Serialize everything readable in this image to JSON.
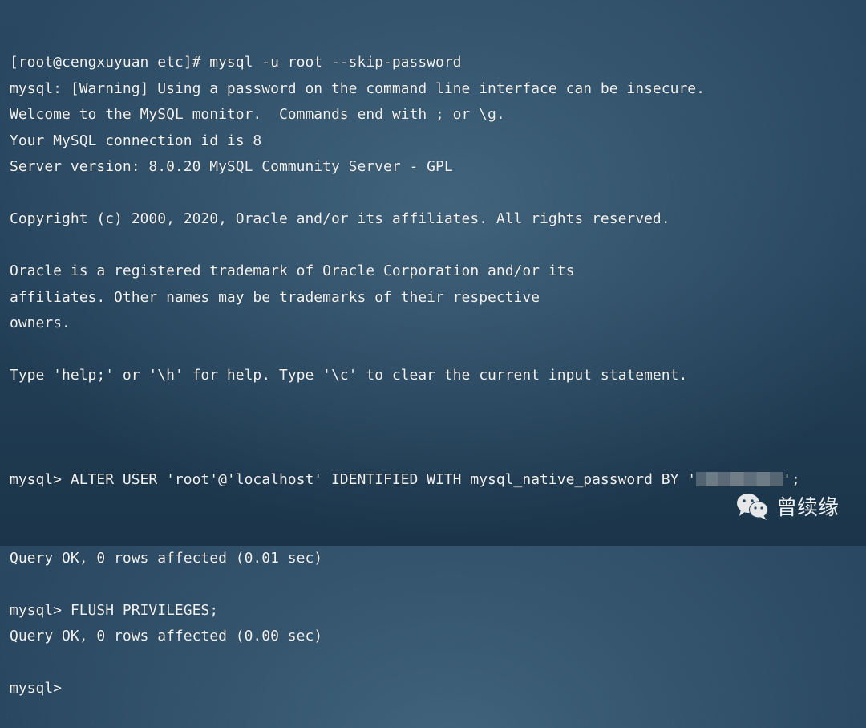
{
  "terminal": {
    "lines": [
      "[root@cengxuyuan etc]# mysql -u root --skip-password",
      "mysql: [Warning] Using a password on the command line interface can be insecure.",
      "Welcome to the MySQL monitor.  Commands end with ; or \\g.",
      "Your MySQL connection id is 8",
      "Server version: 8.0.20 MySQL Community Server - GPL",
      "",
      "Copyright (c) 2000, 2020, Oracle and/or its affiliates. All rights reserved.",
      "",
      "Oracle is a registered trademark of Oracle Corporation and/or its",
      "affiliates. Other names may be trademarks of their respective",
      "owners.",
      "",
      "Type 'help;' or '\\h' for help. Type '\\c' to clear the current input statement.",
      ""
    ],
    "alter_prefix": "mysql> ALTER USER 'root'@'localhost' IDENTIFIED WITH mysql_native_password BY '",
    "alter_suffix": "';",
    "lines_after": [
      "Query OK, 0 rows affected (0.01 sec)",
      "",
      "mysql> FLUSH PRIVILEGES;",
      "Query OK, 0 rows affected (0.00 sec)",
      "",
      "mysql> "
    ]
  },
  "watermark": {
    "icon": "wechat-icon",
    "text": "曾续缘"
  }
}
